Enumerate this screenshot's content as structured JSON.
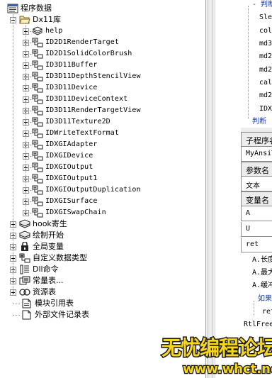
{
  "tree": {
    "root_label": "程序数据",
    "dx11_folder_label": "Dx11库",
    "dx11_children": [
      {
        "label": "help",
        "icon": "help-book-icon"
      },
      {
        "label": "ID2D1RenderTarget",
        "icon": "class-module-icon"
      },
      {
        "label": "ID2D1SolidColorBrush",
        "icon": "class-module-icon"
      },
      {
        "label": "ID3D11Buffer",
        "icon": "class-module-icon"
      },
      {
        "label": "ID3D11DepthStencilView",
        "icon": "class-module-icon"
      },
      {
        "label": "ID3D11Device",
        "icon": "class-module-icon"
      },
      {
        "label": "ID3D11DeviceContext",
        "icon": "class-module-icon"
      },
      {
        "label": "ID3D11RenderTargetView",
        "icon": "class-module-icon"
      },
      {
        "label": "ID3D11Texture2D",
        "icon": "class-module-icon"
      },
      {
        "label": "IDWriteTextFormat",
        "icon": "class-module-icon"
      },
      {
        "label": "IDXGIAdapter",
        "icon": "class-module-icon"
      },
      {
        "label": "IDXGIDevice",
        "icon": "class-module-icon"
      },
      {
        "label": "IDXGIOutput",
        "icon": "class-module-icon"
      },
      {
        "label": "IDXGIOutput1",
        "icon": "class-module-icon"
      },
      {
        "label": "IDXGIOutputDuplication",
        "icon": "class-module-icon"
      },
      {
        "label": "IDXGISurface",
        "icon": "class-module-icon"
      },
      {
        "label": "IDXGISwapChain",
        "icon": "class-module-icon"
      }
    ],
    "top_items": [
      {
        "label": "hook寄生",
        "icon": "module-book-icon"
      },
      {
        "label": "绘制开始",
        "icon": "module-book-icon"
      },
      {
        "label": "全局变量",
        "icon": "global-variable-icon"
      },
      {
        "label": "自定义数据类型",
        "icon": "custom-type-icon"
      },
      {
        "label": "Dll命令",
        "icon": "dll-command-icon"
      },
      {
        "label": "常量表...",
        "icon": "constant-table-icon"
      },
      {
        "label": "资源表",
        "icon": "resource-table-icon"
      },
      {
        "label": "模块引用表",
        "icon": "module-reference-icon"
      },
      {
        "label": "外部文件记录表",
        "icon": "external-file-icon"
      }
    ]
  },
  "code": {
    "lines": [
      {
        "text": "- 判断",
        "kind": "keyword"
      },
      {
        "text": "Sle",
        "kind": "code"
      },
      {
        "text": "col",
        "kind": "code"
      },
      {
        "text": "md3",
        "kind": "code"
      },
      {
        "text": "md2",
        "kind": "code"
      },
      {
        "text": "md2",
        "kind": "code"
      },
      {
        "text": "cal",
        "kind": "code"
      },
      {
        "text": "md2",
        "kind": "code"
      },
      {
        "text": "IDX",
        "kind": "code"
      },
      {
        "text": "判断",
        "kind": "keyword"
      }
    ],
    "subroutine_header": "子程序名",
    "subroutine_name": "MyAnsiT",
    "param_header": "参数名",
    "param_value": "文本",
    "var_header": "变量名",
    "vars": [
      "A",
      "U",
      "ret"
    ],
    "tail_lines": [
      {
        "text": "A.长度",
        "kind": "code"
      },
      {
        "text": "A.最大长",
        "kind": "code"
      },
      {
        "text": "A.缓冲区",
        "kind": "code"
      },
      {
        "text": "如果",
        "kind": "keyword"
      },
      {
        "text": "ret",
        "kind": "code"
      },
      {
        "text": "RtlFree",
        "kind": "code"
      }
    ]
  },
  "watermark": {
    "title": "无忧编程论坛",
    "url": "www.whct.net"
  },
  "colors": {
    "keyword": "#1a3fb5",
    "watermark_fill": "#f7d51c",
    "watermark_outline": "#1c1c1c"
  }
}
